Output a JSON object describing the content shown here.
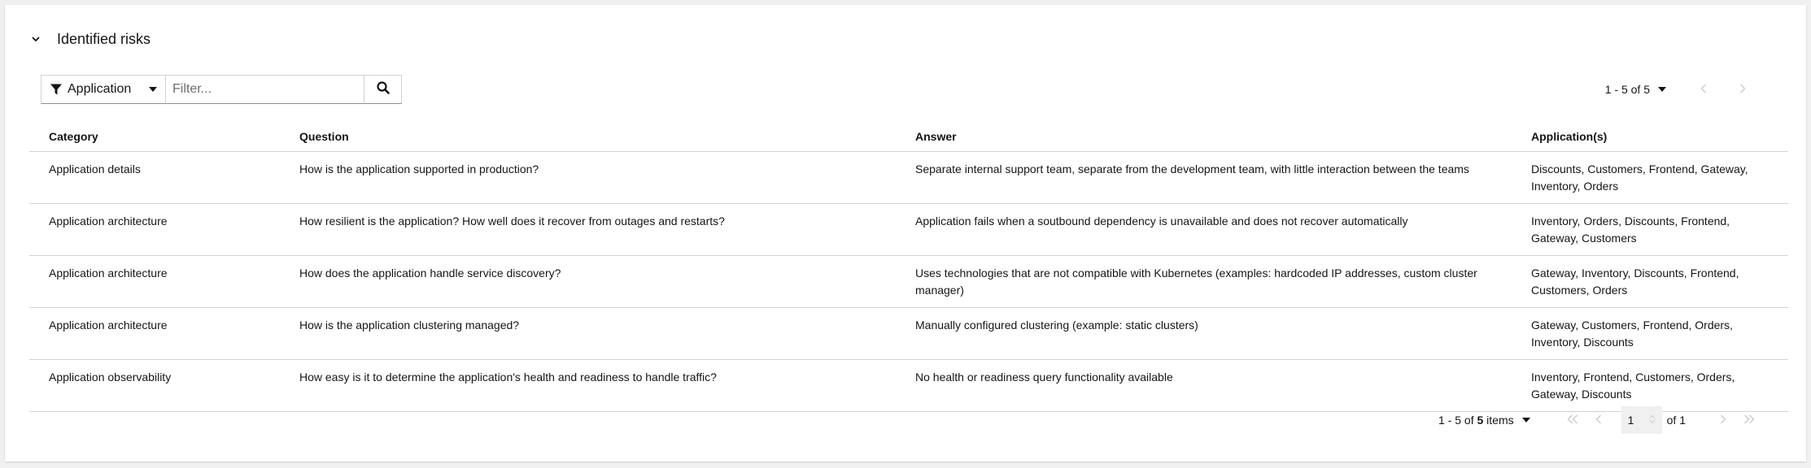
{
  "section": {
    "title": "Identified risks",
    "toggle_icon": "chevron-down-icon"
  },
  "toolbar": {
    "filter_attribute": "Application",
    "filter_placeholder": "Filter...",
    "filter_value": ""
  },
  "pagination_top": {
    "range": "1 - 5 of 5"
  },
  "table": {
    "headers": [
      "Category",
      "Question",
      "Answer",
      "Application(s)"
    ],
    "rows": [
      {
        "category": "Application details",
        "question": "How is the application supported in production?",
        "answer": "Separate internal support team, separate from the development team, with little interaction between the teams",
        "applications": "Discounts, Customers, Frontend, Gateway, Inventory, Orders"
      },
      {
        "category": "Application architecture",
        "question": "How resilient is the application? How well does it recover from outages and restarts?",
        "answer": "Application fails when a soutbound dependency is unavailable and does not recover automatically",
        "applications": "Inventory, Orders, Discounts, Frontend, Gateway, Customers"
      },
      {
        "category": "Application architecture",
        "question": "How does the application handle service discovery?",
        "answer": "Uses technologies that are not compatible with Kubernetes (examples: hardcoded IP addresses, custom cluster manager)",
        "applications": "Gateway, Inventory, Discounts, Frontend, Customers, Orders"
      },
      {
        "category": "Application architecture",
        "question": "How is the application clustering managed?",
        "answer": "Manually configured clustering (example: static clusters)",
        "applications": "Gateway, Customers, Frontend, Orders, Inventory, Discounts"
      },
      {
        "category": "Application observability",
        "question": "How easy is it to determine the application's health and readiness to handle traffic?",
        "answer": "No health or readiness query functionality available",
        "applications": "Inventory, Frontend, Customers, Orders, Gateway, Discounts"
      }
    ]
  },
  "pagination_bottom": {
    "range_prefix": "1 - 5 of ",
    "range_total": "5",
    "range_suffix": " items",
    "page": "1",
    "of_total": "of 1"
  }
}
